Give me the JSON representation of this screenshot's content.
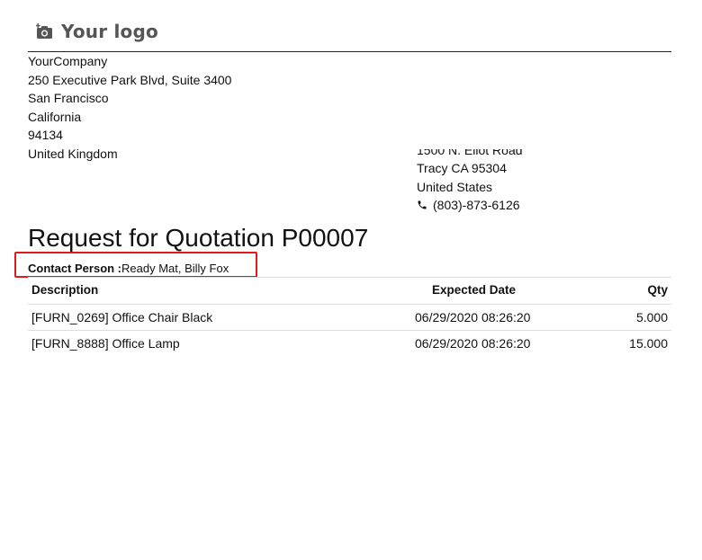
{
  "logo": {
    "icon": "camera-plus-icon",
    "text": "Your logo"
  },
  "company": {
    "lines": [
      "YourCompany",
      "250 Executive Park Blvd, Suite 3400",
      "San Francisco",
      "California",
      "94134",
      "United Kingdom"
    ]
  },
  "vendor": {
    "street_clipped": "1500 N. Eliot Road",
    "city_line": "Tracy CA 95304",
    "country": "United States",
    "phone_icon": "phone-icon",
    "phone": "(803)-873-6126"
  },
  "document": {
    "title": "Request for Quotation P00007",
    "contact_label": "Contact Person :",
    "contact_value": "Ready Mat, Billy Fox",
    "highlight_color": "#e01b1b"
  },
  "table": {
    "headers": {
      "description": "Description",
      "expected_date": "Expected Date",
      "qty": "Qty"
    },
    "rows": [
      {
        "description": "[FURN_0269] Office Chair Black",
        "expected_date": "06/29/2020 08:26:20",
        "qty": "5.000"
      },
      {
        "description": "[FURN_8888] Office Lamp",
        "expected_date": "06/29/2020 08:26:20",
        "qty": "15.000"
      }
    ]
  }
}
